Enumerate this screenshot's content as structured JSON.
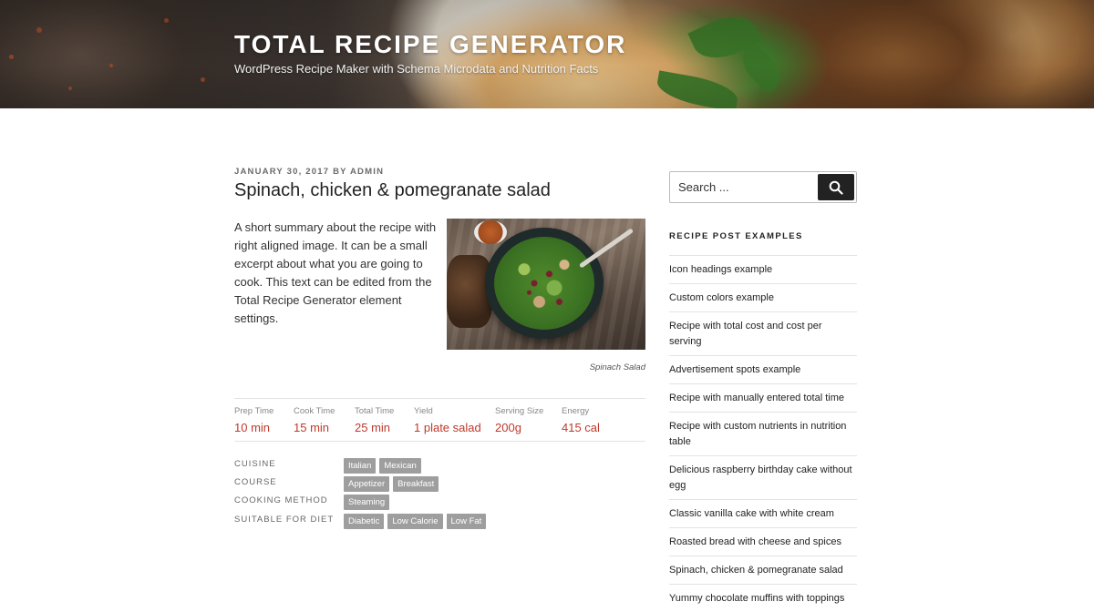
{
  "header": {
    "site_title": "TOTAL RECIPE GENERATOR",
    "site_description": "WordPress Recipe Maker with Schema Microdata and Nutrition Facts"
  },
  "post": {
    "date": "JANUARY 30, 2017",
    "by": "BY",
    "author": "ADMIN",
    "title": "Spinach, chicken & pomegranate salad",
    "summary": "A short summary about the recipe with right aligned image. It can be a small excerpt about what you are going to cook. This text can be edited from the Total Recipe Generator element settings.",
    "image_caption": "Spinach Salad"
  },
  "details": [
    {
      "label": "Prep Time",
      "value": "10 min"
    },
    {
      "label": "Cook Time",
      "value": "15 min"
    },
    {
      "label": "Total Time",
      "value": "25 min"
    },
    {
      "label": "Yield",
      "value": "1 plate salad"
    },
    {
      "label": "Serving Size",
      "value": "200g"
    },
    {
      "label": "Energy",
      "value": "415 cal"
    }
  ],
  "taxonomies": [
    {
      "label": "CUISINE",
      "tags": [
        "Italian",
        "Mexican"
      ]
    },
    {
      "label": "COURSE",
      "tags": [
        "Appetizer",
        "Breakfast"
      ]
    },
    {
      "label": "COOKING METHOD",
      "tags": [
        "Steaming"
      ]
    },
    {
      "label": "SUITABLE FOR DIET",
      "tags": [
        "Diabetic",
        "Low Calorie",
        "Low Fat"
      ]
    }
  ],
  "sidebar": {
    "search_placeholder": "Search ...",
    "widget_title": "RECIPE POST EXAMPLES",
    "posts": [
      "Icon headings example",
      "Custom colors example",
      "Recipe with total cost and cost per serving",
      "Advertisement spots example",
      "Recipe with manually entered total time",
      "Recipe with custom nutrients in nutrition table",
      "Delicious raspberry birthday cake without egg",
      "Classic vanilla cake with white cream",
      "Roasted bread with cheese and spices",
      "Spinach, chicken & pomegranate salad",
      "Yummy chocolate muffins with toppings"
    ]
  },
  "colors": {
    "accent_red": "#c0392b",
    "tag_gray": "#9e9e9e",
    "search_button": "#222222"
  },
  "icons": {
    "search_button_icon": "search-icon"
  }
}
